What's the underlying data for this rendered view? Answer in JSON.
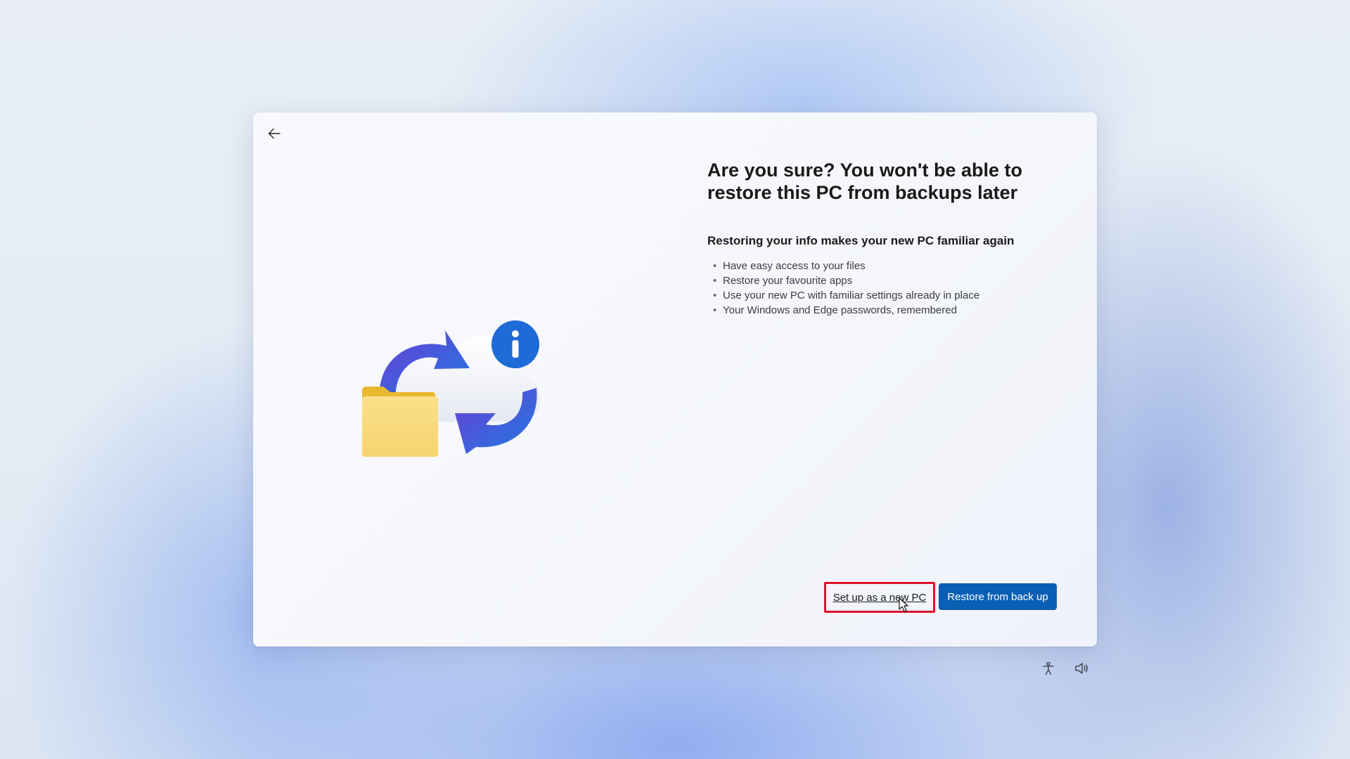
{
  "window": {
    "title": "Are you sure? You won't be able to restore this PC from backups later",
    "subtitle": "Restoring your info makes your new PC familiar again",
    "bullets": [
      "Have easy access to your files",
      "Restore your favourite apps",
      "Use your new PC with familiar settings already in place",
      "Your Windows and Edge passwords, remembered"
    ],
    "bullet_glyph": "•"
  },
  "buttons": {
    "setup_new": "Set up as a new PC",
    "restore": "Restore from back up"
  },
  "icons": {
    "back": "arrow-left-icon",
    "illustration": "restore-backup-illustration",
    "accessibility": "accessibility-icon",
    "volume": "volume-icon"
  },
  "colors": {
    "primary_button": "#0a5fb4",
    "highlight_border": "#e0102a",
    "arrow_gradient_start": "#6a3fd6",
    "arrow_gradient_end": "#1f7ae0",
    "folder": "#f7d978",
    "folder_tab": "#e8b830"
  }
}
